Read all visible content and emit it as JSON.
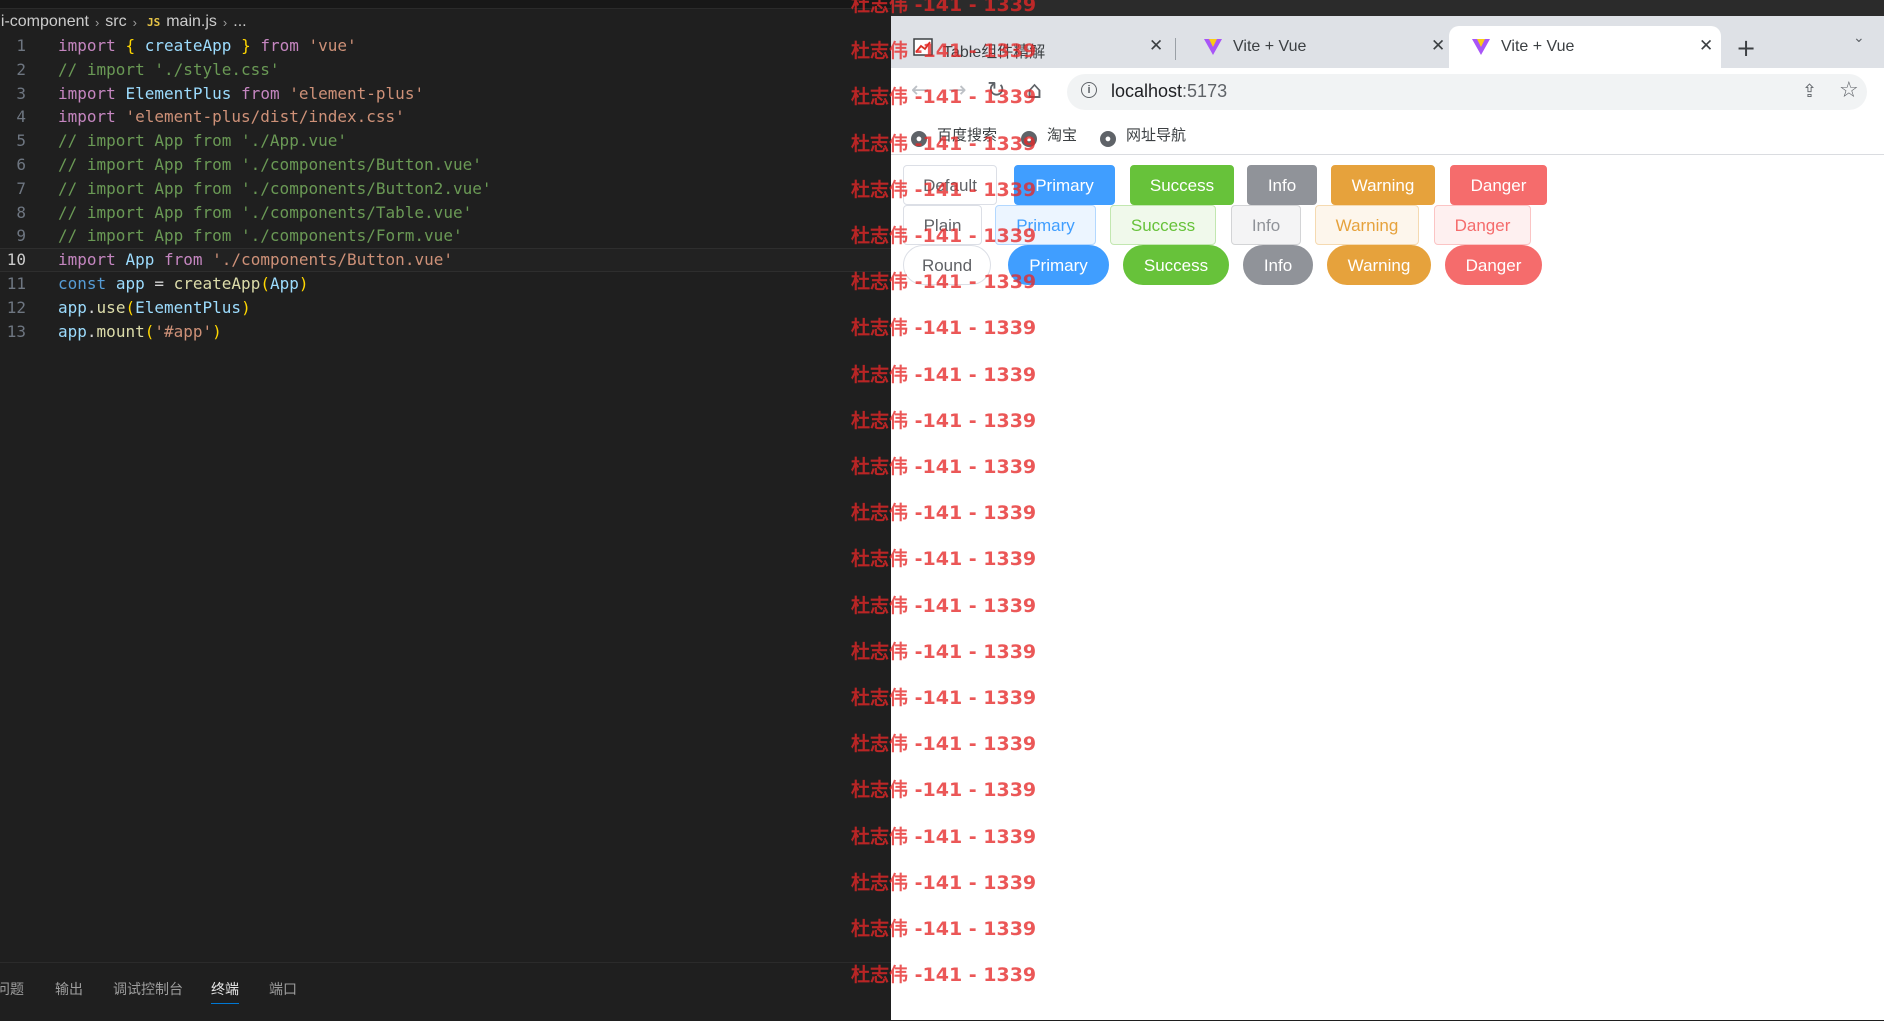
{
  "editor": {
    "breadcrumb": {
      "root": "ui-component",
      "folder": "src",
      "file_badge": "JS",
      "file": "main.js",
      "more": "..."
    },
    "lines": [
      {
        "n": "1",
        "tokens": [
          [
            "kw",
            "import"
          ],
          [
            "pl",
            " "
          ],
          [
            "br",
            "{"
          ],
          [
            "pl",
            " "
          ],
          [
            "vr",
            "createApp"
          ],
          [
            "pl",
            " "
          ],
          [
            "br",
            "}"
          ],
          [
            "pl",
            " "
          ],
          [
            "kw",
            "from"
          ],
          [
            "pl",
            " "
          ],
          [
            "str",
            "'vue'"
          ]
        ]
      },
      {
        "n": "2",
        "tokens": [
          [
            "cm",
            "// import './style.css'"
          ]
        ]
      },
      {
        "n": "3",
        "tokens": [
          [
            "kw",
            "import"
          ],
          [
            "pl",
            " "
          ],
          [
            "vr",
            "ElementPlus"
          ],
          [
            "pl",
            " "
          ],
          [
            "kw",
            "from"
          ],
          [
            "pl",
            " "
          ],
          [
            "str",
            "'element-plus'"
          ]
        ]
      },
      {
        "n": "4",
        "tokens": [
          [
            "kw",
            "import"
          ],
          [
            "pl",
            " "
          ],
          [
            "str",
            "'element-plus/dist/index.css'"
          ]
        ]
      },
      {
        "n": "5",
        "tokens": [
          [
            "cm",
            "// import App from './App.vue'"
          ]
        ]
      },
      {
        "n": "6",
        "tokens": [
          [
            "cm",
            "// import App from './components/Button.vue'"
          ]
        ]
      },
      {
        "n": "7",
        "tokens": [
          [
            "cm",
            "// import App from './components/Button2.vue'"
          ]
        ]
      },
      {
        "n": "8",
        "tokens": [
          [
            "cm",
            "// import App from './components/Table.vue'"
          ]
        ]
      },
      {
        "n": "9",
        "tokens": [
          [
            "cm",
            "// import App from './components/Form.vue'"
          ]
        ]
      },
      {
        "n": "10",
        "active": true,
        "tokens": [
          [
            "kw",
            "import"
          ],
          [
            "pl",
            " "
          ],
          [
            "vr",
            "App"
          ],
          [
            "pl",
            " "
          ],
          [
            "kw",
            "from"
          ],
          [
            "pl",
            " "
          ],
          [
            "str",
            "'./components/Button.vue'"
          ]
        ]
      },
      {
        "n": "11",
        "tokens": [
          [
            "blue",
            "const"
          ],
          [
            "pl",
            " "
          ],
          [
            "vr",
            "app"
          ],
          [
            "pl",
            " = "
          ],
          [
            "fn",
            "createApp"
          ],
          [
            "br",
            "("
          ],
          [
            "vr",
            "App"
          ],
          [
            "br",
            ")"
          ]
        ]
      },
      {
        "n": "12",
        "tokens": [
          [
            "vr",
            "app"
          ],
          [
            "pl",
            "."
          ],
          [
            "fn",
            "use"
          ],
          [
            "br",
            "("
          ],
          [
            "vr",
            "ElementPlus"
          ],
          [
            "br",
            ")"
          ]
        ]
      },
      {
        "n": "13",
        "tokens": [
          [
            "vr",
            "app"
          ],
          [
            "pl",
            "."
          ],
          [
            "fn",
            "mount"
          ],
          [
            "br",
            "("
          ],
          [
            "str",
            "'#app'"
          ],
          [
            "br",
            ")"
          ]
        ]
      }
    ],
    "panel_tabs": [
      "问题",
      "输出",
      "调试控制台",
      "终端",
      "端口"
    ],
    "panel_active": "终端"
  },
  "browser": {
    "tabs": [
      {
        "title": "Table组件精解",
        "close": "✕",
        "favicon": "chart"
      },
      {
        "title": "Vite + Vue",
        "close": "✕",
        "favicon": "vite"
      },
      {
        "title": "Vite + Vue",
        "close": "✕",
        "favicon": "vite",
        "active": true
      }
    ],
    "new_tab": "+",
    "tab_menu": "⌄",
    "nav": {
      "back": "←",
      "forward": "→",
      "reload": "↻",
      "home": "⌂"
    },
    "url_host": "localhost",
    "url_port": ":5173",
    "bookmarks": [
      "百度搜索",
      "淘宝",
      "网址导航"
    ],
    "buttons": {
      "row1": [
        "Default",
        "Primary",
        "Success",
        "Info",
        "Warning",
        "Danger"
      ],
      "row2": [
        "Plain",
        "Primary",
        "Success",
        "Info",
        "Warning",
        "Danger"
      ],
      "row3": [
        "Round",
        "Primary",
        "Success",
        "Info",
        "Warning",
        "Danger"
      ]
    }
  },
  "watermark": {
    "text": "杜志伟 -141 - 1339",
    "color": "#e62828",
    "count": 22
  },
  "colors": {
    "primary": "#409eff",
    "success": "#67c23a",
    "info": "#909399",
    "warning": "#e6a23c",
    "danger": "#f56c6c"
  }
}
